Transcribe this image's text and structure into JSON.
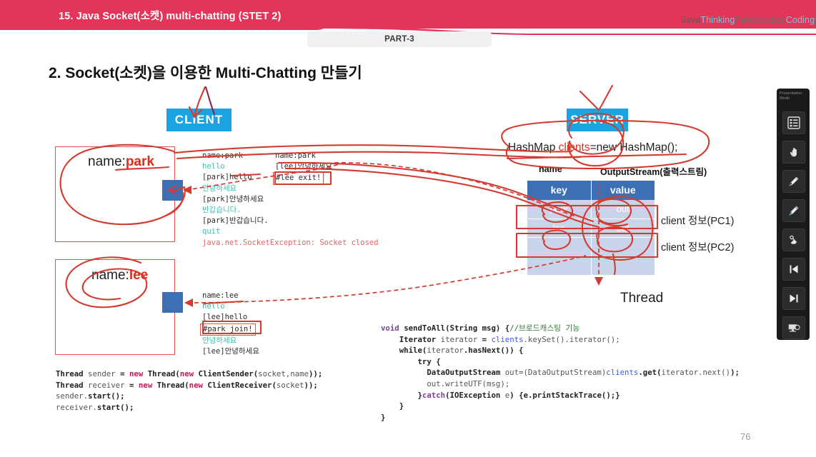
{
  "header": {
    "title": "15. Java Socket(소켓) multi-chatting (STET 2)",
    "part_tab": "PART-3",
    "brand": {
      "java": "Java",
      "thinking": "Thinking",
      "presentation": "Presentation",
      "coding": "Coding"
    },
    "band_color": "#E2355A"
  },
  "slide": {
    "title": "2. Socket(소켓)을 이용한 Multi-Chatting 만들기",
    "page_number": "76"
  },
  "client": {
    "box_label": "CLIENT",
    "box_color": "#1CA3E2",
    "window_park": {
      "name_prefix": "name:",
      "name_value": "park"
    },
    "window_lee": {
      "name_prefix": "name:",
      "name_value": "lee"
    }
  },
  "server": {
    "box_label": "SERVER",
    "box_color": "#1CA3E2",
    "hashmap_line": {
      "before": "HashMap ",
      "highlight": "clients",
      "after": "=new HashMap();"
    },
    "col_label_name": "name",
    "col_label_outputstream": "OutputStream(출력스트림)",
    "table": {
      "headers": [
        "key",
        "value"
      ],
      "rows": [
        [
          "park",
          "out"
        ],
        [
          "lee",
          "out"
        ],
        [
          "",
          ""
        ],
        [
          "",
          ""
        ]
      ]
    },
    "client_info_1": "client 정보(PC1)",
    "client_info_2": "client 정보(PC2)",
    "thread_label": "Thread"
  },
  "console_park_left": [
    {
      "text": "name:park",
      "color": "dark"
    },
    {
      "text": "hello",
      "color": "teal"
    },
    {
      "text": "[park]hello",
      "color": "dark"
    },
    {
      "text": "안녕하세요",
      "color": "teal"
    },
    {
      "text": "[park]안녕하세요",
      "color": "dark"
    },
    {
      "text": "반갑습니다.",
      "color": "teal"
    },
    {
      "text": "[park]반갑습니다.",
      "color": "dark"
    },
    {
      "text": "quit",
      "color": "teal"
    },
    {
      "text": "java.net.SocketException: Socket closed",
      "color": "red"
    }
  ],
  "console_park_right": [
    {
      "text": "name:park",
      "color": "dark",
      "boxed": false
    },
    {
      "text": "[lee]안녕하세요",
      "color": "dark",
      "boxed": false
    },
    {
      "text": "#lee exit!",
      "color": "dark",
      "boxed": true
    }
  ],
  "console_lee": [
    {
      "text": "name:lee",
      "color": "dark",
      "boxed": false
    },
    {
      "text": "hello",
      "color": "teal",
      "boxed": false
    },
    {
      "text": "[lee]hello",
      "color": "dark",
      "boxed": false
    },
    {
      "text": "#park join!",
      "color": "dark",
      "boxed": true
    },
    {
      "text": "안녕하세요",
      "color": "teal",
      "boxed": false
    },
    {
      "text": "[lee]안녕하세요",
      "color": "dark",
      "boxed": false
    }
  ],
  "code_left": [
    [
      {
        "t": "Thread ",
        "c": "k-dark"
      },
      {
        "t": "sender ",
        "c": "k-gray"
      },
      {
        "t": "= ",
        "c": "k-dark"
      },
      {
        "t": "new ",
        "c": "k-pink"
      },
      {
        "t": "Thread(",
        "c": "k-dark"
      },
      {
        "t": "new ",
        "c": "k-pink"
      },
      {
        "t": "ClientSender(",
        "c": "k-dark"
      },
      {
        "t": "socket,name",
        "c": "k-gray"
      },
      {
        "t": "));",
        "c": "k-dark"
      }
    ],
    [
      {
        "t": "Thread ",
        "c": "k-dark"
      },
      {
        "t": "receiver ",
        "c": "k-gray"
      },
      {
        "t": "= ",
        "c": "k-dark"
      },
      {
        "t": "new ",
        "c": "k-pink"
      },
      {
        "t": "Thread(",
        "c": "k-dark"
      },
      {
        "t": "new ",
        "c": "k-pink"
      },
      {
        "t": "ClientReceiver(",
        "c": "k-dark"
      },
      {
        "t": "socket",
        "c": "k-gray"
      },
      {
        "t": "));",
        "c": "k-dark"
      }
    ],
    [
      {
        "t": "sender.",
        "c": "k-gray"
      },
      {
        "t": "start();",
        "c": "k-dark"
      }
    ],
    [
      {
        "t": "receiver.",
        "c": "k-gray"
      },
      {
        "t": "start();",
        "c": "k-dark"
      }
    ]
  ],
  "code_right": [
    [
      {
        "t": "void ",
        "c": "k-purple"
      },
      {
        "t": "sendToAll(String msg) {",
        "c": "k-dark"
      },
      {
        "t": "//브로드캐스팅 기능",
        "c": "k-green"
      }
    ],
    [
      {
        "t": "    Iterator ",
        "c": "k-dark"
      },
      {
        "t": "iterator ",
        "c": "k-gray"
      },
      {
        "t": "= ",
        "c": "k-dark"
      },
      {
        "t": "clients",
        "c": "k-blue"
      },
      {
        "t": ".keySet().iterator();",
        "c": "k-gray"
      }
    ],
    [
      {
        "t": "    while(",
        "c": "k-dark"
      },
      {
        "t": "iterator",
        "c": "k-gray"
      },
      {
        "t": ".hasNext()) {",
        "c": "k-dark"
      }
    ],
    [
      {
        "t": "        try {",
        "c": "k-dark"
      }
    ],
    [
      {
        "t": "          DataOutputStream ",
        "c": "k-dark"
      },
      {
        "t": "out=(DataOutputStream)",
        "c": "k-gray"
      },
      {
        "t": "clients",
        "c": "k-blue"
      },
      {
        "t": ".get(",
        "c": "k-dark"
      },
      {
        "t": "iterator.next()",
        "c": "k-gray"
      },
      {
        "t": ");",
        "c": "k-dark"
      }
    ],
    [
      {
        "t": "          out.writeUTF(",
        "c": "k-gray"
      },
      {
        "t": "msg",
        "c": "k-gray"
      },
      {
        "t": ");",
        "c": "k-gray"
      }
    ],
    [
      {
        "t": "        }",
        "c": "k-dark"
      },
      {
        "t": "catch",
        "c": "k-purple"
      },
      {
        "t": "(IOException ",
        "c": "k-dark"
      },
      {
        "t": "e",
        "c": "k-gray"
      },
      {
        "t": ") {e.printStackTrace();}",
        "c": "k-dark"
      }
    ],
    [
      {
        "t": "    }",
        "c": "k-dark"
      }
    ],
    [
      {
        "t": "}",
        "c": "k-dark"
      }
    ]
  ],
  "toolbar": {
    "label": "Presentation Mode",
    "buttons": [
      {
        "name": "slide-list-icon",
        "title": "Slide list"
      },
      {
        "name": "hand-pointer-icon",
        "title": "Pointer"
      },
      {
        "name": "pen-black-icon",
        "title": "Pen"
      },
      {
        "name": "pen-blue-icon",
        "title": "Highlighter"
      },
      {
        "name": "eraser-icon",
        "title": "Eraser"
      },
      {
        "name": "previous-slide-icon",
        "title": "Previous"
      },
      {
        "name": "next-slide-icon",
        "title": "Next"
      },
      {
        "name": "end-show-icon",
        "title": "End show"
      }
    ]
  },
  "ink_color": "#D43B30"
}
